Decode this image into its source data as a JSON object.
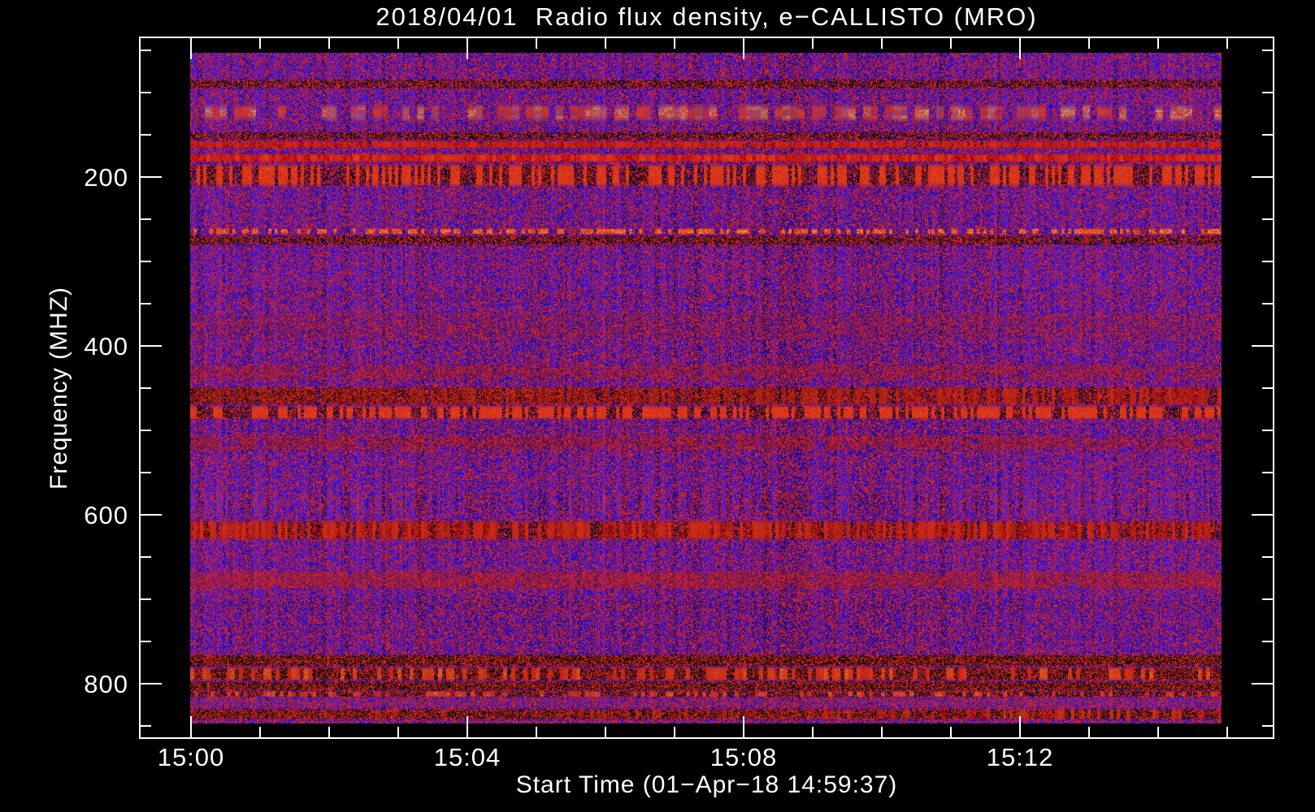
{
  "chart_data": {
    "type": "heatmap",
    "variant": "radio_spectrogram",
    "title": "2018/04/01  Radio flux density, e−CALLISTO (MRO)",
    "xlabel": "Start Time (01−Apr−18 14:59:37)",
    "ylabel": "Frequency (MHZ)",
    "x_ticks": [
      "15:00",
      "15:04",
      "15:08",
      "15:12"
    ],
    "x_minor_tick_interval": "1 min",
    "y_ticks": [
      "200",
      "400",
      "600",
      "800"
    ],
    "y_minor_tick_interval_mhz": 50,
    "y_axis_direction": "frequency increases downward",
    "freq_range_mhz": [
      52,
      846
    ],
    "time_start_label": "14:59:37",
    "legend": "none",
    "grid": "off",
    "palette": {
      "frame_and_text": "#ffffff",
      "page_background": "#000000",
      "quiet_blue": "#2213e8",
      "dim_blue": "#140b9e",
      "dark": "#06030e",
      "maroon": "#7c1420",
      "red": "#d22810",
      "orange": "#ff7a1c",
      "hot_yellow": "#ffc860",
      "purple": "#5a28c8"
    },
    "bands": [
      {
        "mhz": [
          84,
          95
        ],
        "style": "dark_dashes",
        "level": 0.55
      },
      {
        "mhz": [
          112,
          136
        ],
        "style": "hot_blobs",
        "level": 0.8
      },
      {
        "mhz": [
          146,
          156
        ],
        "style": "dark_dashes",
        "level": 0.5
      },
      {
        "mhz": [
          157,
          165
        ],
        "style": "red_dashes",
        "level": 0.35
      },
      {
        "mhz": [
          172,
          182
        ],
        "style": "red_dashes",
        "level": 0.9
      },
      {
        "mhz": [
          184,
          212
        ],
        "style": "dark_band",
        "level": 0.75
      },
      {
        "mhz": [
          261,
          267
        ],
        "style": "dot_row",
        "level": 0.5
      },
      {
        "mhz": [
          268,
          281
        ],
        "style": "dark_dashes",
        "level": 0.55
      },
      {
        "mhz": [
          330,
          350
        ],
        "style": "dim_band",
        "level": 0.3
      },
      {
        "mhz": [
          358,
          393
        ],
        "style": "maroon_mottle",
        "level": 0.45
      },
      {
        "mhz": [
          405,
          415
        ],
        "style": "dark_dashes_red",
        "level": 0.6
      },
      {
        "mhz": [
          419,
          442
        ],
        "style": "maroon_blobs",
        "level": 0.5
      },
      {
        "mhz": [
          447,
          470
        ],
        "style": "dark_band_red",
        "level": 0.9,
        "brighter_right": true
      },
      {
        "mhz": [
          470,
          487
        ],
        "style": "dark_band",
        "level": 0.65
      },
      {
        "mhz": [
          504,
          525
        ],
        "style": "maroon_blobs",
        "level": 0.6
      },
      {
        "mhz": [
          534,
          549
        ],
        "style": "dark_dashes_red",
        "level": 0.55
      },
      {
        "mhz": [
          571,
          601
        ],
        "style": "stripe_band",
        "level": 0.6
      },
      {
        "mhz": [
          606,
          630
        ],
        "style": "dark_band_red",
        "level": 0.85
      },
      {
        "mhz": [
          644,
          664
        ],
        "style": "dark_dashes_red",
        "level": 0.75
      },
      {
        "mhz": [
          665,
          688
        ],
        "style": "red_mottle",
        "level": 0.6
      },
      {
        "mhz": [
          698,
          714
        ],
        "style": "dim_band",
        "level": 0.3
      },
      {
        "mhz": [
          764,
          780
        ],
        "style": "dark_band_orange",
        "level": 0.85,
        "brighter_right": true
      },
      {
        "mhz": [
          780,
          796
        ],
        "style": "hot_band",
        "level": 1.0,
        "brighter_right": true
      },
      {
        "mhz": [
          796,
          809
        ],
        "style": "dark_band_orange",
        "level": 0.9,
        "brighter_right": true
      },
      {
        "mhz": [
          809,
          815
        ],
        "style": "hot_band",
        "level": 0.85,
        "brighter_right": true
      },
      {
        "mhz": [
          815,
          829
        ],
        "style": "purple_mottle",
        "level": 0.6
      },
      {
        "mhz": [
          829,
          842
        ],
        "style": "red_mottle_strong",
        "level": 0.85,
        "brighter_right": true
      },
      {
        "mhz": [
          842,
          847
        ],
        "style": "purple_mottle",
        "level": 0.5
      }
    ]
  }
}
